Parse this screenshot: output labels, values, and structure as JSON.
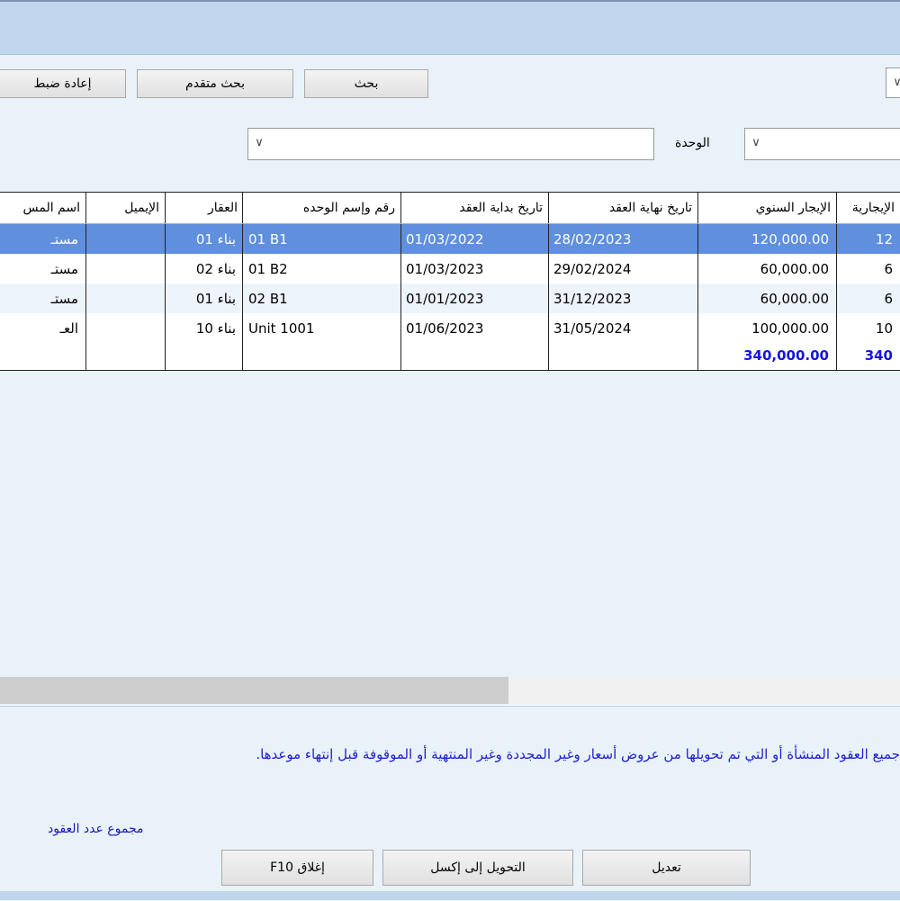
{
  "toolbar": {
    "search_label": "بحث",
    "advanced_search_label": "بحث متقدم",
    "reset_label": "إعادة ضبط"
  },
  "filters": {
    "unit_label": "الوحدة",
    "unit_value": "",
    "right_value": ""
  },
  "icons": {
    "dropdown": "chevron-down-icon"
  },
  "grid": {
    "columns": [
      "الإيجارية",
      "الإيجار السنوي",
      "تاريخ نهاية العقد",
      "تاريخ بداية العقد",
      "رقم وإسم الوحده",
      "العقار",
      "الإيميل",
      "اسم المس"
    ],
    "rows": [
      {
        "rent_partial": "12",
        "annual_rent": "120,000.00",
        "end_date": "28/02/2023",
        "start_date": "01/03/2022",
        "unit": "01 B1",
        "property": "بناء 01",
        "email": "",
        "name": "مستـ",
        "selected": true
      },
      {
        "rent_partial": "6",
        "annual_rent": "60,000.00",
        "end_date": "29/02/2024",
        "start_date": "01/03/2023",
        "unit": "01 B2",
        "property": "بناء 02",
        "email": "",
        "name": "مستـ",
        "selected": false
      },
      {
        "rent_partial": "6",
        "annual_rent": "60,000.00",
        "end_date": "31/12/2023",
        "start_date": "01/01/2023",
        "unit": "02 B1",
        "property": "بناء 01",
        "email": "",
        "name": "مستـ",
        "selected": false
      },
      {
        "rent_partial": "10",
        "annual_rent": "100,000.00",
        "end_date": "31/05/2024",
        "start_date": "01/06/2023",
        "unit": "Unit 1001",
        "property": "بناء 10",
        "email": "",
        "name": "العـ",
        "selected": false
      }
    ],
    "totals": {
      "rent_partial": "340",
      "annual_rent": "340,000.00"
    }
  },
  "colors": {
    "selected_row": "#5f8fdd",
    "alt_row": "#eef4fb",
    "total_text": "#1515e0"
  },
  "footer": {
    "note": "جميع العقود المنشأة أو التي تم تحويلها من عروض أسعار وغير المجددة وغير المنتهية أو الموقوفة قبل إنتهاء موعدها.",
    "sum_label": "مجموع عدد العقود",
    "edit_label": "تعديل",
    "excel_label": "التحويل إلى إكسل",
    "close_label": "إغلاق F10"
  }
}
